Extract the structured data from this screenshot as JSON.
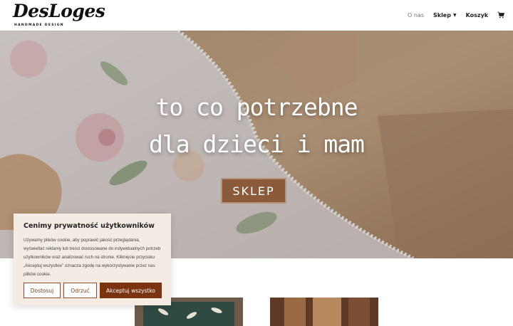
{
  "header": {
    "logo_text": "DesLoges",
    "logo_subtitle": "HANDMADE DESIGN",
    "nav": [
      {
        "label": "O nas",
        "active": true
      },
      {
        "label": "Sklep",
        "has_dropdown": true
      },
      {
        "label": "Koszyk"
      }
    ],
    "cart_icon": "cart-icon"
  },
  "hero": {
    "line1": "to co potrzebne",
    "line2": "dla dzieci i mam",
    "button_label": "SKLEP"
  },
  "cookie": {
    "title": "Cenimy prywatność użytkowników",
    "text": "Używamy plików cookie, aby poprawić jakość przeglądania, wyświetlać reklamy lub treści dostosowane do indywidualnych potrzeb użytkowników oraz analizować ruch na stronie. Kliknięcie przycisku „Akceptuj wszystkie” oznacza zgodę na wykorzystywanie przez nas plików cookie.",
    "buttons": {
      "customize": "Dostosuj",
      "reject": "Odrzuć",
      "accept": "Akceptuj wszystko"
    }
  },
  "colors": {
    "accent": "#7a3510",
    "hero_button": "#8b5a3a",
    "cookie_bg": "#f4ece4"
  }
}
